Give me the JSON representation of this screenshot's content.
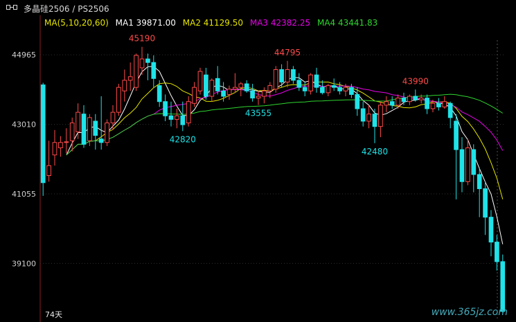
{
  "title": "多晶硅2506 / PS2506",
  "legend": {
    "params": "MA(5,10,20,60)",
    "ma1": "MA1 39871.00",
    "ma2": "MA2 41129.50",
    "ma3": "MA3 42382.25",
    "ma4": "MA4 43441.83"
  },
  "footer": "74天",
  "watermark": "www.365jz.com",
  "colors": {
    "up": "#ff4a4a",
    "down": "#1fe3e8",
    "ma1": "#ffffff",
    "ma2": "#e6e600",
    "ma3": "#e800e8",
    "ma4": "#2fd62f",
    "grid": "#2e2e2e",
    "axis": "#8a1e1e"
  },
  "chart_data": {
    "type": "candlestick",
    "y_ticks": [
      44965,
      43010,
      41055,
      39100
    ],
    "ylim": [
      37550,
      45650
    ],
    "annotations": [
      {
        "label": "45190",
        "bar": 17,
        "pos": "high",
        "color": "up"
      },
      {
        "label": "42820",
        "bar": 24,
        "pos": "low",
        "color": "down"
      },
      {
        "label": "43555",
        "bar": 37,
        "pos": "low",
        "color": "down"
      },
      {
        "label": "44795",
        "bar": 42,
        "pos": "high",
        "color": "up"
      },
      {
        "label": "42480",
        "bar": 57,
        "pos": "low",
        "color": "down"
      },
      {
        "label": "43990",
        "bar": 64,
        "pos": "high",
        "color": "up"
      }
    ],
    "candles": [
      [
        44120,
        44180,
        41000,
        41370
      ],
      [
        41570,
        42550,
        41400,
        41850
      ],
      [
        42150,
        42850,
        41850,
        42500
      ],
      [
        42350,
        42680,
        42100,
        42500
      ],
      [
        42500,
        42900,
        42200,
        42520
      ],
      [
        42550,
        43200,
        42250,
        43050
      ],
      [
        42800,
        43600,
        42600,
        43350
      ],
      [
        43300,
        43550,
        42350,
        42450
      ],
      [
        42550,
        43300,
        42400,
        43200
      ],
      [
        43100,
        43300,
        42300,
        42700
      ],
      [
        42600,
        43800,
        42300,
        42500
      ],
      [
        42500,
        43150,
        42400,
        43050
      ],
      [
        43050,
        43550,
        42850,
        43350
      ],
      [
        43350,
        44150,
        43250,
        44050
      ],
      [
        43950,
        44550,
        43650,
        44250
      ],
      [
        44250,
        44750,
        43950,
        44350
      ],
      [
        44050,
        45000,
        43950,
        44950
      ],
      [
        44600,
        45190,
        44400,
        44850
      ],
      [
        44850,
        45000,
        44250,
        44750
      ],
      [
        44750,
        44950,
        44050,
        44300
      ],
      [
        44100,
        44250,
        43500,
        43650
      ],
      [
        43650,
        43850,
        43100,
        43250
      ],
      [
        43250,
        43650,
        42950,
        43150
      ],
      [
        43150,
        43450,
        42900,
        43250
      ],
      [
        43250,
        43650,
        42820,
        43000
      ],
      [
        43050,
        43800,
        42950,
        43650
      ],
      [
        43600,
        44200,
        43500,
        44050
      ],
      [
        43950,
        44600,
        43850,
        44500
      ],
      [
        44400,
        44600,
        43700,
        43800
      ],
      [
        43800,
        44300,
        43650,
        44250
      ],
      [
        44300,
        44650,
        43850,
        43950
      ],
      [
        43950,
        44200,
        43650,
        43800
      ],
      [
        43850,
        44100,
        43700,
        44000
      ],
      [
        44000,
        44450,
        43900,
        44050
      ],
      [
        44050,
        44200,
        43800,
        44150
      ],
      [
        44150,
        44250,
        43900,
        43950
      ],
      [
        43950,
        44150,
        43650,
        43750
      ],
      [
        43750,
        43950,
        43555,
        43800
      ],
      [
        43800,
        44050,
        43600,
        43950
      ],
      [
        43950,
        44200,
        43750,
        44100
      ],
      [
        44000,
        44650,
        43900,
        44550
      ],
      [
        44550,
        44700,
        44050,
        44200
      ],
      [
        44200,
        44795,
        44050,
        44550
      ],
      [
        44550,
        44650,
        44150,
        44250
      ],
      [
        44250,
        44450,
        43950,
        44050
      ],
      [
        44050,
        44200,
        43800,
        43950
      ],
      [
        43950,
        44450,
        43850,
        44400
      ],
      [
        44400,
        44600,
        43900,
        44050
      ],
      [
        44050,
        44250,
        43850,
        43900
      ],
      [
        43900,
        44150,
        43800,
        44100
      ],
      [
        44100,
        44300,
        43950,
        44050
      ],
      [
        44050,
        44200,
        43850,
        43950
      ],
      [
        43950,
        44150,
        43800,
        44050
      ],
      [
        44050,
        44150,
        43750,
        43850
      ],
      [
        43850,
        44050,
        43250,
        43450
      ],
      [
        43450,
        43650,
        42950,
        43100
      ],
      [
        43100,
        43550,
        42900,
        43300
      ],
      [
        43300,
        43450,
        42480,
        42950
      ],
      [
        42950,
        43650,
        42650,
        43550
      ],
      [
        43550,
        43800,
        43350,
        43650
      ],
      [
        43650,
        43800,
        43450,
        43550
      ],
      [
        43550,
        43850,
        43450,
        43750
      ],
      [
        43750,
        43900,
        43550,
        43650
      ],
      [
        43650,
        43850,
        43550,
        43800
      ],
      [
        43800,
        43990,
        43650,
        43700
      ],
      [
        43700,
        43850,
        43600,
        43750
      ],
      [
        43750,
        43850,
        43300,
        43450
      ],
      [
        43450,
        43700,
        43350,
        43600
      ],
      [
        43600,
        43750,
        43400,
        43500
      ],
      [
        43500,
        43800,
        43450,
        43650
      ],
      [
        43600,
        43650,
        42900,
        43200
      ],
      [
        43100,
        43300,
        40900,
        42300
      ],
      [
        42300,
        42650,
        41100,
        41400
      ],
      [
        41400,
        42600,
        41300,
        42350
      ],
      [
        42300,
        42450,
        41100,
        41600
      ],
      [
        41600,
        41800,
        40400,
        41200
      ],
      [
        41200,
        41400,
        39900,
        40400
      ],
      [
        40400,
        40600,
        39300,
        39700
      ],
      [
        39700,
        39900,
        38900,
        39150
      ],
      [
        39150,
        39350,
        37700,
        37750
      ]
    ],
    "ma_lines": [
      {
        "name": "MA1",
        "color": "ma1",
        "period": 5
      },
      {
        "name": "MA2",
        "color": "ma2",
        "period": 10
      },
      {
        "name": "MA3",
        "color": "ma3",
        "period": 20
      },
      {
        "name": "MA4",
        "color": "ma4",
        "period": 60
      }
    ]
  }
}
